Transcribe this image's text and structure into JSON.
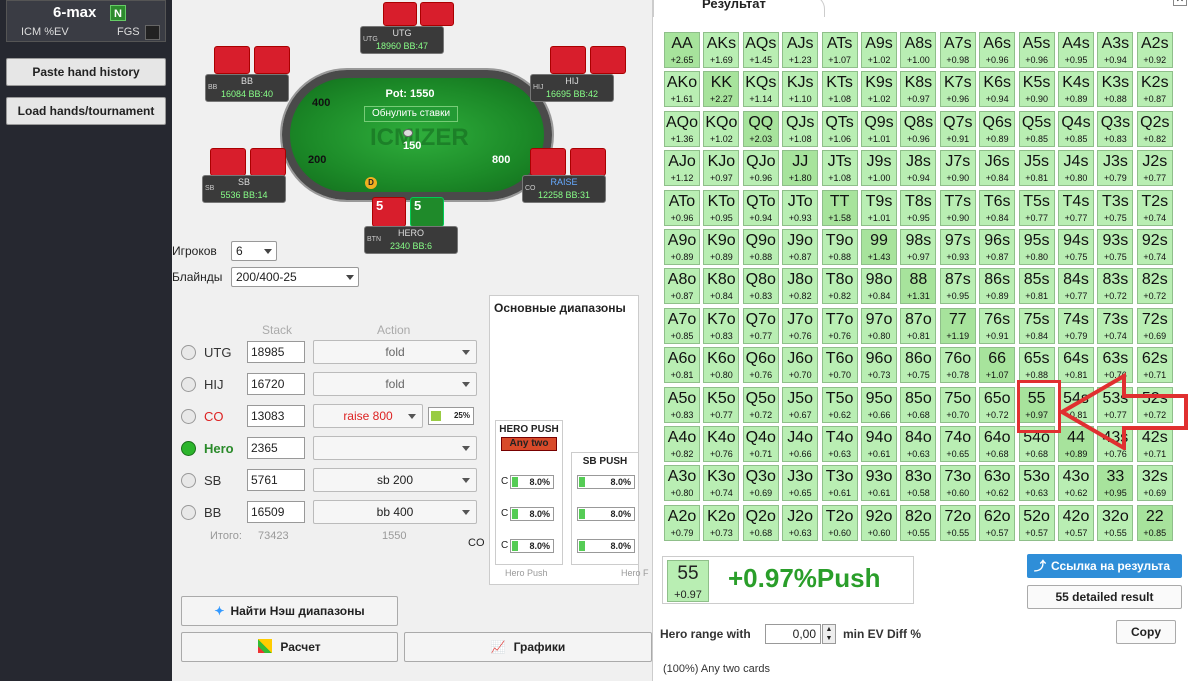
{
  "sidebar": {
    "title": "6-max",
    "badge": "N",
    "icm": "ICM %EV",
    "fgs": "FGS",
    "paste": "Paste hand history",
    "load": "Load hands/tournament"
  },
  "table": {
    "pot": "Pot: 1550",
    "reset": "Обнулить ставки",
    "watermark": "ICMIZER",
    "seats": {
      "utg": {
        "pos": "UTG",
        "name": "UTG",
        "stack": "18960 BB:47"
      },
      "hij": {
        "pos": "HIJ",
        "name": "HIJ",
        "stack": "16695 BB:42"
      },
      "bb": {
        "pos": "BB",
        "name": "BB",
        "stack": "16084 BB:40"
      },
      "sb": {
        "pos": "SB",
        "name": "SB",
        "stack": "5536 BB:14"
      },
      "co": {
        "pos": "CO",
        "name": "RAISE",
        "stack": "12258 BB:31"
      },
      "hero": {
        "pos": "BTN",
        "name": "HERO",
        "stack": "2340 BB:6"
      }
    },
    "chips": {
      "bb": "400",
      "sb": "200",
      "center": "150",
      "co": "800"
    },
    "hero_cards": [
      "5",
      "5"
    ],
    "dealer": "D"
  },
  "setup": {
    "players_label": "Игроков",
    "players_value": "6",
    "blinds_label": "Блайнды",
    "blinds_value": "200/400-25",
    "stack_header": "Stack",
    "action_header": "Action",
    "rows": [
      {
        "pos": "UTG",
        "stack": "18985",
        "action": "fold"
      },
      {
        "pos": "HIJ",
        "stack": "16720",
        "action": "fold"
      },
      {
        "pos": "CO",
        "stack": "13083",
        "action": "raise 800",
        "pct": "25%"
      },
      {
        "pos": "Hero",
        "stack": "2365",
        "action": ""
      },
      {
        "pos": "SB",
        "stack": "5761",
        "action": "sb 200"
      },
      {
        "pos": "BB",
        "stack": "16509",
        "action": "bb 400"
      }
    ],
    "total_label": "Итого:",
    "total_stack": "73423",
    "total_action": "1550"
  },
  "ranges": {
    "tab": "Основные диапазоны",
    "hero_push": "HERO PUSH",
    "any_two": "Any two",
    "sb_push": "SB PUSH",
    "co_label": "CO",
    "c": "C",
    "pct": "8.0%",
    "foot1": "Hero Push",
    "foot2": "Hero F"
  },
  "buttons": {
    "nash": "Найти Нэш диапазоны",
    "calc": "Расчет",
    "graphs": "Графики"
  },
  "result": {
    "title": "Результат",
    "grid": [
      [
        "AA",
        "+2.65"
      ],
      [
        "AKs",
        "+1.69"
      ],
      [
        "AQs",
        "+1.45"
      ],
      [
        "AJs",
        "+1.23"
      ],
      [
        "ATs",
        "+1.07"
      ],
      [
        "A9s",
        "+1.02"
      ],
      [
        "A8s",
        "+1.00"
      ],
      [
        "A7s",
        "+0.98"
      ],
      [
        "A6s",
        "+0.96"
      ],
      [
        "A5s",
        "+0.96"
      ],
      [
        "A4s",
        "+0.95"
      ],
      [
        "A3s",
        "+0.94"
      ],
      [
        "A2s",
        "+0.92"
      ],
      [
        "AKo",
        "+1.61"
      ],
      [
        "KK",
        "+2.27"
      ],
      [
        "KQs",
        "+1.14"
      ],
      [
        "KJs",
        "+1.10"
      ],
      [
        "KTs",
        "+1.08"
      ],
      [
        "K9s",
        "+1.02"
      ],
      [
        "K8s",
        "+0.97"
      ],
      [
        "K7s",
        "+0.96"
      ],
      [
        "K6s",
        "+0.94"
      ],
      [
        "K5s",
        "+0.90"
      ],
      [
        "K4s",
        "+0.89"
      ],
      [
        "K3s",
        "+0.88"
      ],
      [
        "K2s",
        "+0.87"
      ],
      [
        "AQo",
        "+1.36"
      ],
      [
        "KQo",
        "+1.02"
      ],
      [
        "QQ",
        "+2.03"
      ],
      [
        "QJs",
        "+1.08"
      ],
      [
        "QTs",
        "+1.06"
      ],
      [
        "Q9s",
        "+1.01"
      ],
      [
        "Q8s",
        "+0.96"
      ],
      [
        "Q7s",
        "+0.91"
      ],
      [
        "Q6s",
        "+0.89"
      ],
      [
        "Q5s",
        "+0.85"
      ],
      [
        "Q4s",
        "+0.85"
      ],
      [
        "Q3s",
        "+0.83"
      ],
      [
        "Q2s",
        "+0.82"
      ],
      [
        "AJo",
        "+1.12"
      ],
      [
        "KJo",
        "+0.97"
      ],
      [
        "QJo",
        "+0.96"
      ],
      [
        "JJ",
        "+1.80"
      ],
      [
        "JTs",
        "+1.08"
      ],
      [
        "J9s",
        "+1.00"
      ],
      [
        "J8s",
        "+0.94"
      ],
      [
        "J7s",
        "+0.90"
      ],
      [
        "J6s",
        "+0.84"
      ],
      [
        "J5s",
        "+0.81"
      ],
      [
        "J4s",
        "+0.80"
      ],
      [
        "J3s",
        "+0.79"
      ],
      [
        "J2s",
        "+0.77"
      ],
      [
        "ATo",
        "+0.96"
      ],
      [
        "KTo",
        "+0.95"
      ],
      [
        "QTo",
        "+0.94"
      ],
      [
        "JTo",
        "+0.93"
      ],
      [
        "TT",
        "+1.58"
      ],
      [
        "T9s",
        "+1.01"
      ],
      [
        "T8s",
        "+0.95"
      ],
      [
        "T7s",
        "+0.90"
      ],
      [
        "T6s",
        "+0.84"
      ],
      [
        "T5s",
        "+0.77"
      ],
      [
        "T4s",
        "+0.77"
      ],
      [
        "T3s",
        "+0.75"
      ],
      [
        "T2s",
        "+0.74"
      ],
      [
        "A9o",
        "+0.89"
      ],
      [
        "K9o",
        "+0.89"
      ],
      [
        "Q9o",
        "+0.88"
      ],
      [
        "J9o",
        "+0.87"
      ],
      [
        "T9o",
        "+0.88"
      ],
      [
        "99",
        "+1.43"
      ],
      [
        "98s",
        "+0.97"
      ],
      [
        "97s",
        "+0.93"
      ],
      [
        "96s",
        "+0.87"
      ],
      [
        "95s",
        "+0.80"
      ],
      [
        "94s",
        "+0.75"
      ],
      [
        "93s",
        "+0.75"
      ],
      [
        "92s",
        "+0.74"
      ],
      [
        "A8o",
        "+0.87"
      ],
      [
        "K8o",
        "+0.84"
      ],
      [
        "Q8o",
        "+0.83"
      ],
      [
        "J8o",
        "+0.82"
      ],
      [
        "T8o",
        "+0.82"
      ],
      [
        "98o",
        "+0.84"
      ],
      [
        "88",
        "+1.31"
      ],
      [
        "87s",
        "+0.95"
      ],
      [
        "86s",
        "+0.89"
      ],
      [
        "85s",
        "+0.81"
      ],
      [
        "84s",
        "+0.77"
      ],
      [
        "83s",
        "+0.72"
      ],
      [
        "82s",
        "+0.72"
      ],
      [
        "A7o",
        "+0.85"
      ],
      [
        "K7o",
        "+0.83"
      ],
      [
        "Q7o",
        "+0.77"
      ],
      [
        "J7o",
        "+0.76"
      ],
      [
        "T7o",
        "+0.76"
      ],
      [
        "97o",
        "+0.80"
      ],
      [
        "87o",
        "+0.81"
      ],
      [
        "77",
        "+1.19"
      ],
      [
        "76s",
        "+0.91"
      ],
      [
        "75s",
        "+0.84"
      ],
      [
        "74s",
        "+0.79"
      ],
      [
        "73s",
        "+0.74"
      ],
      [
        "72s",
        "+0.69"
      ],
      [
        "A6o",
        "+0.81"
      ],
      [
        "K6o",
        "+0.80"
      ],
      [
        "Q6o",
        "+0.76"
      ],
      [
        "J6o",
        "+0.70"
      ],
      [
        "T6o",
        "+0.70"
      ],
      [
        "96o",
        "+0.73"
      ],
      [
        "86o",
        "+0.75"
      ],
      [
        "76o",
        "+0.78"
      ],
      [
        "66",
        "+1.07"
      ],
      [
        "65s",
        "+0.88"
      ],
      [
        "64s",
        "+0.81"
      ],
      [
        "63s",
        "+0.76"
      ],
      [
        "62s",
        "+0.71"
      ],
      [
        "A5o",
        "+0.83"
      ],
      [
        "K5o",
        "+0.77"
      ],
      [
        "Q5o",
        "+0.72"
      ],
      [
        "J5o",
        "+0.67"
      ],
      [
        "T5o",
        "+0.62"
      ],
      [
        "95o",
        "+0.66"
      ],
      [
        "85o",
        "+0.68"
      ],
      [
        "75o",
        "+0.70"
      ],
      [
        "65o",
        "+0.72"
      ],
      [
        "55",
        "+0.97"
      ],
      [
        "54s",
        "+0.81"
      ],
      [
        "53s",
        "+0.77"
      ],
      [
        "52s",
        "+0.72"
      ],
      [
        "A4o",
        "+0.82"
      ],
      [
        "K4o",
        "+0.76"
      ],
      [
        "Q4o",
        "+0.71"
      ],
      [
        "J4o",
        "+0.66"
      ],
      [
        "T4o",
        "+0.63"
      ],
      [
        "94o",
        "+0.61"
      ],
      [
        "84o",
        "+0.63"
      ],
      [
        "74o",
        "+0.65"
      ],
      [
        "64o",
        "+0.68"
      ],
      [
        "54o",
        "+0.68"
      ],
      [
        "44",
        "+0.89"
      ],
      [
        "43s",
        "+0.76"
      ],
      [
        "42s",
        "+0.71"
      ],
      [
        "A3o",
        "+0.80"
      ],
      [
        "K3o",
        "+0.74"
      ],
      [
        "Q3o",
        "+0.69"
      ],
      [
        "J3o",
        "+0.65"
      ],
      [
        "T3o",
        "+0.61"
      ],
      [
        "93o",
        "+0.61"
      ],
      [
        "83o",
        "+0.58"
      ],
      [
        "73o",
        "+0.60"
      ],
      [
        "63o",
        "+0.62"
      ],
      [
        "53o",
        "+0.63"
      ],
      [
        "43o",
        "+0.62"
      ],
      [
        "33",
        "+0.95"
      ],
      [
        "32s",
        "+0.69"
      ],
      [
        "A2o",
        "+0.79"
      ],
      [
        "K2o",
        "+0.73"
      ],
      [
        "Q2o",
        "+0.68"
      ],
      [
        "J2o",
        "+0.63"
      ],
      [
        "T2o",
        "+0.60"
      ],
      [
        "92o",
        "+0.60"
      ],
      [
        "82o",
        "+0.55"
      ],
      [
        "72o",
        "+0.55"
      ],
      [
        "62o",
        "+0.57"
      ],
      [
        "52o",
        "+0.57"
      ],
      [
        "42o",
        "+0.57"
      ],
      [
        "32o",
        "+0.55"
      ],
      [
        "22",
        "+0.85"
      ]
    ],
    "selected_hand": "55",
    "selected_ev": "+0.97",
    "selected_result": "+0.97%Push",
    "share": "Ссылка на результа",
    "detailed": "55 detailed result",
    "copy": "Copy",
    "hero_range_label": "Hero range with",
    "hero_range_value": "0,00",
    "min_ev_label": "min EV Diff %",
    "any_two_note": "(100%) Any two cards"
  }
}
